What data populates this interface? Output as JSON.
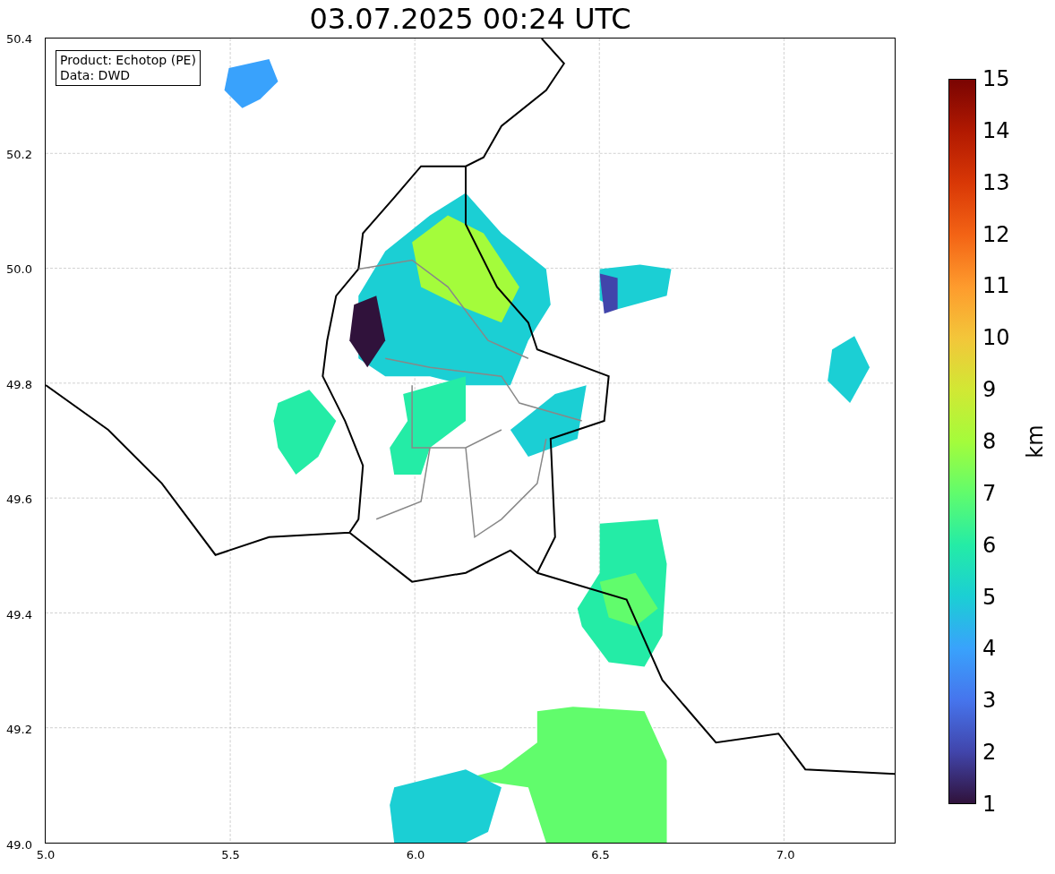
{
  "title": "03.07.2025 00:24 UTC",
  "info_box": {
    "lines": [
      "Product: Echotop (PE)",
      "Data: DWD"
    ]
  },
  "map": {
    "x_ticks": [
      "5.0",
      "5.5",
      "6.0",
      "6.5",
      "7.0"
    ],
    "y_ticks": [
      "50.4",
      "50.2",
      "50.0",
      "49.8",
      "49.6",
      "49.4",
      "49.2",
      "49.0"
    ]
  },
  "colorbar": {
    "ticks": [
      "15",
      "14",
      "13",
      "12",
      "11",
      "10",
      "9",
      "8",
      "7",
      "6",
      "5",
      "4",
      "3",
      "2",
      "1"
    ],
    "label": "km"
  }
}
